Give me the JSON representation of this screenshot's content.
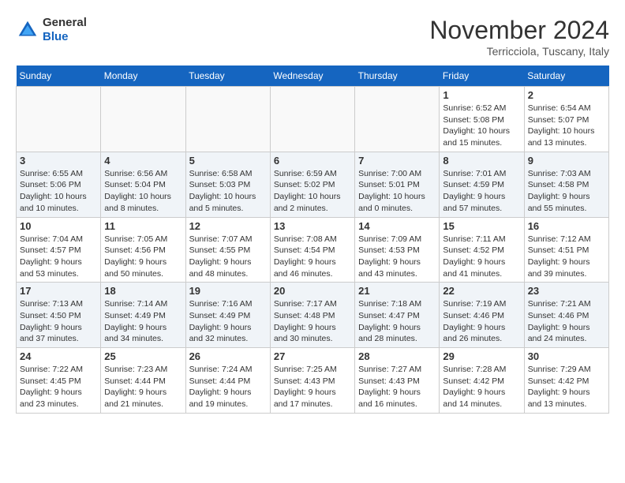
{
  "header": {
    "logo_general": "General",
    "logo_blue": "Blue",
    "month": "November 2024",
    "location": "Terricciola, Tuscany, Italy"
  },
  "days_of_week": [
    "Sunday",
    "Monday",
    "Tuesday",
    "Wednesday",
    "Thursday",
    "Friday",
    "Saturday"
  ],
  "weeks": [
    {
      "days": [
        {
          "num": "",
          "info": ""
        },
        {
          "num": "",
          "info": ""
        },
        {
          "num": "",
          "info": ""
        },
        {
          "num": "",
          "info": ""
        },
        {
          "num": "",
          "info": ""
        },
        {
          "num": "1",
          "info": "Sunrise: 6:52 AM\nSunset: 5:08 PM\nDaylight: 10 hours\nand 15 minutes."
        },
        {
          "num": "2",
          "info": "Sunrise: 6:54 AM\nSunset: 5:07 PM\nDaylight: 10 hours\nand 13 minutes."
        }
      ]
    },
    {
      "days": [
        {
          "num": "3",
          "info": "Sunrise: 6:55 AM\nSunset: 5:06 PM\nDaylight: 10 hours\nand 10 minutes."
        },
        {
          "num": "4",
          "info": "Sunrise: 6:56 AM\nSunset: 5:04 PM\nDaylight: 10 hours\nand 8 minutes."
        },
        {
          "num": "5",
          "info": "Sunrise: 6:58 AM\nSunset: 5:03 PM\nDaylight: 10 hours\nand 5 minutes."
        },
        {
          "num": "6",
          "info": "Sunrise: 6:59 AM\nSunset: 5:02 PM\nDaylight: 10 hours\nand 2 minutes."
        },
        {
          "num": "7",
          "info": "Sunrise: 7:00 AM\nSunset: 5:01 PM\nDaylight: 10 hours\nand 0 minutes."
        },
        {
          "num": "8",
          "info": "Sunrise: 7:01 AM\nSunset: 4:59 PM\nDaylight: 9 hours\nand 57 minutes."
        },
        {
          "num": "9",
          "info": "Sunrise: 7:03 AM\nSunset: 4:58 PM\nDaylight: 9 hours\nand 55 minutes."
        }
      ]
    },
    {
      "days": [
        {
          "num": "10",
          "info": "Sunrise: 7:04 AM\nSunset: 4:57 PM\nDaylight: 9 hours\nand 53 minutes."
        },
        {
          "num": "11",
          "info": "Sunrise: 7:05 AM\nSunset: 4:56 PM\nDaylight: 9 hours\nand 50 minutes."
        },
        {
          "num": "12",
          "info": "Sunrise: 7:07 AM\nSunset: 4:55 PM\nDaylight: 9 hours\nand 48 minutes."
        },
        {
          "num": "13",
          "info": "Sunrise: 7:08 AM\nSunset: 4:54 PM\nDaylight: 9 hours\nand 46 minutes."
        },
        {
          "num": "14",
          "info": "Sunrise: 7:09 AM\nSunset: 4:53 PM\nDaylight: 9 hours\nand 43 minutes."
        },
        {
          "num": "15",
          "info": "Sunrise: 7:11 AM\nSunset: 4:52 PM\nDaylight: 9 hours\nand 41 minutes."
        },
        {
          "num": "16",
          "info": "Sunrise: 7:12 AM\nSunset: 4:51 PM\nDaylight: 9 hours\nand 39 minutes."
        }
      ]
    },
    {
      "days": [
        {
          "num": "17",
          "info": "Sunrise: 7:13 AM\nSunset: 4:50 PM\nDaylight: 9 hours\nand 37 minutes."
        },
        {
          "num": "18",
          "info": "Sunrise: 7:14 AM\nSunset: 4:49 PM\nDaylight: 9 hours\nand 34 minutes."
        },
        {
          "num": "19",
          "info": "Sunrise: 7:16 AM\nSunset: 4:49 PM\nDaylight: 9 hours\nand 32 minutes."
        },
        {
          "num": "20",
          "info": "Sunrise: 7:17 AM\nSunset: 4:48 PM\nDaylight: 9 hours\nand 30 minutes."
        },
        {
          "num": "21",
          "info": "Sunrise: 7:18 AM\nSunset: 4:47 PM\nDaylight: 9 hours\nand 28 minutes."
        },
        {
          "num": "22",
          "info": "Sunrise: 7:19 AM\nSunset: 4:46 PM\nDaylight: 9 hours\nand 26 minutes."
        },
        {
          "num": "23",
          "info": "Sunrise: 7:21 AM\nSunset: 4:46 PM\nDaylight: 9 hours\nand 24 minutes."
        }
      ]
    },
    {
      "days": [
        {
          "num": "24",
          "info": "Sunrise: 7:22 AM\nSunset: 4:45 PM\nDaylight: 9 hours\nand 23 minutes."
        },
        {
          "num": "25",
          "info": "Sunrise: 7:23 AM\nSunset: 4:44 PM\nDaylight: 9 hours\nand 21 minutes."
        },
        {
          "num": "26",
          "info": "Sunrise: 7:24 AM\nSunset: 4:44 PM\nDaylight: 9 hours\nand 19 minutes."
        },
        {
          "num": "27",
          "info": "Sunrise: 7:25 AM\nSunset: 4:43 PM\nDaylight: 9 hours\nand 17 minutes."
        },
        {
          "num": "28",
          "info": "Sunrise: 7:27 AM\nSunset: 4:43 PM\nDaylight: 9 hours\nand 16 minutes."
        },
        {
          "num": "29",
          "info": "Sunrise: 7:28 AM\nSunset: 4:42 PM\nDaylight: 9 hours\nand 14 minutes."
        },
        {
          "num": "30",
          "info": "Sunrise: 7:29 AM\nSunset: 4:42 PM\nDaylight: 9 hours\nand 13 minutes."
        }
      ]
    }
  ]
}
